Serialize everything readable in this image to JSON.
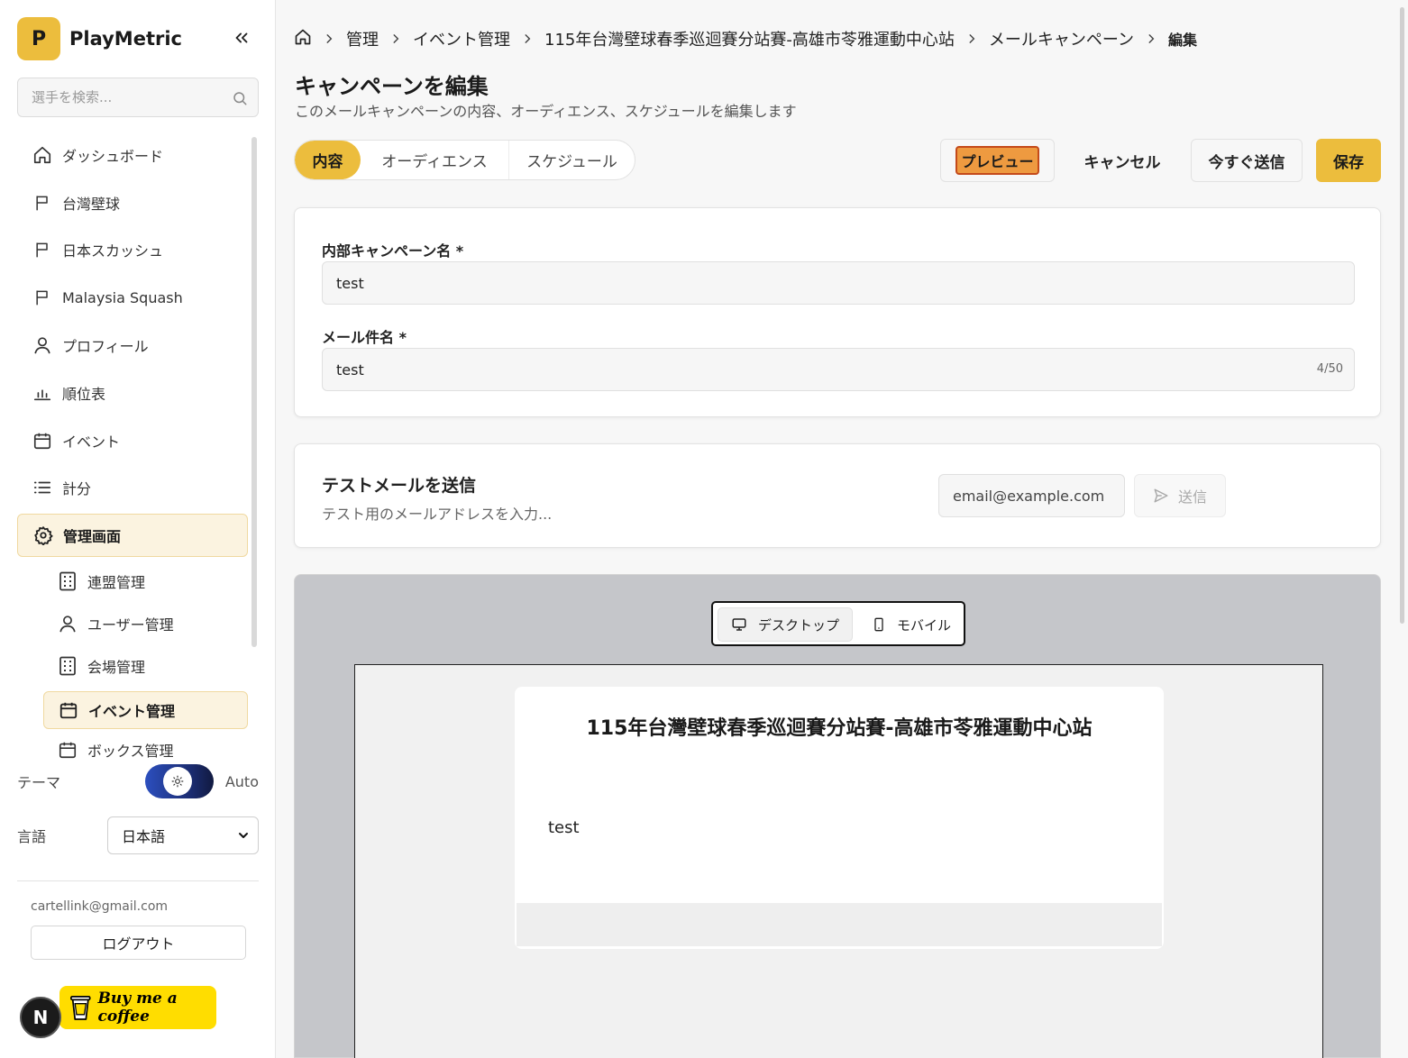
{
  "app": {
    "logo_letter": "P",
    "name": "PlayMetric"
  },
  "sidebar": {
    "search_placeholder": "選手を検索...",
    "items": [
      {
        "label": "ダッシュボード",
        "icon": "home-icon"
      },
      {
        "label": "台灣壁球",
        "icon": "flag-icon"
      },
      {
        "label": "日本スカッシュ",
        "icon": "flag-icon"
      },
      {
        "label": "Malaysia Squash",
        "icon": "flag-icon"
      },
      {
        "label": "プロフィール",
        "icon": "user-icon"
      },
      {
        "label": "順位表",
        "icon": "bar-chart-icon"
      },
      {
        "label": "イベント",
        "icon": "calendar-icon"
      },
      {
        "label": "計分",
        "icon": "list-icon"
      },
      {
        "label": "管理画面",
        "icon": "gear-icon",
        "active": true
      }
    ],
    "sub_items": [
      {
        "label": "連盟管理",
        "icon": "building-icon"
      },
      {
        "label": "ユーザー管理",
        "icon": "user-icon"
      },
      {
        "label": "会場管理",
        "icon": "building-icon"
      },
      {
        "label": "イベント管理",
        "icon": "calendar-icon",
        "active": true
      },
      {
        "label": "ボックス管理",
        "icon": "calendar-icon"
      }
    ],
    "theme": {
      "label": "テーマ",
      "value": "Auto"
    },
    "language": {
      "label": "言語",
      "selected": "日本語"
    },
    "user_email": "cartellink@gmail.com",
    "logout_label": "ログアウト",
    "n_badge": "N",
    "coffee_label": "Buy me a coffee"
  },
  "breadcrumb": {
    "items": [
      "管理",
      "イベント管理",
      "115年台灣壁球春季巡迴賽分站賽-高雄市苓雅運動中心站",
      "メールキャンペーン"
    ],
    "current": "編集"
  },
  "header": {
    "title": "キャンペーンを編集",
    "subtitle": "このメールキャンペーンの内容、オーディエンス、スケジュールを編集します"
  },
  "tabs": [
    "内容",
    "オーディエンス",
    "スケジュール"
  ],
  "actions": {
    "preview": "プレビュー",
    "cancel": "キャンセル",
    "send_now": "今すぐ送信",
    "save": "保存"
  },
  "form": {
    "campaign_name_label": "内部キャンペーン名 *",
    "campaign_name_value": "test",
    "subject_label": "メール件名 *",
    "subject_value": "test",
    "subject_count": "4/50"
  },
  "test_email": {
    "title": "テストメールを送信",
    "description": "テスト用のメールアドレスを入力...",
    "placeholder": "email@example.com",
    "send_label": "送信"
  },
  "preview": {
    "desktop_label": "デスクトップ",
    "mobile_label": "モバイル",
    "email_title": "115年台灣壁球春季巡迴賽分站賽-高雄市苓雅運動中心站",
    "email_body": "test"
  },
  "colors": {
    "accent": "#ecbd3d",
    "active_bg": "#fbf3e0",
    "preview_highlight": "#ee9a40"
  }
}
